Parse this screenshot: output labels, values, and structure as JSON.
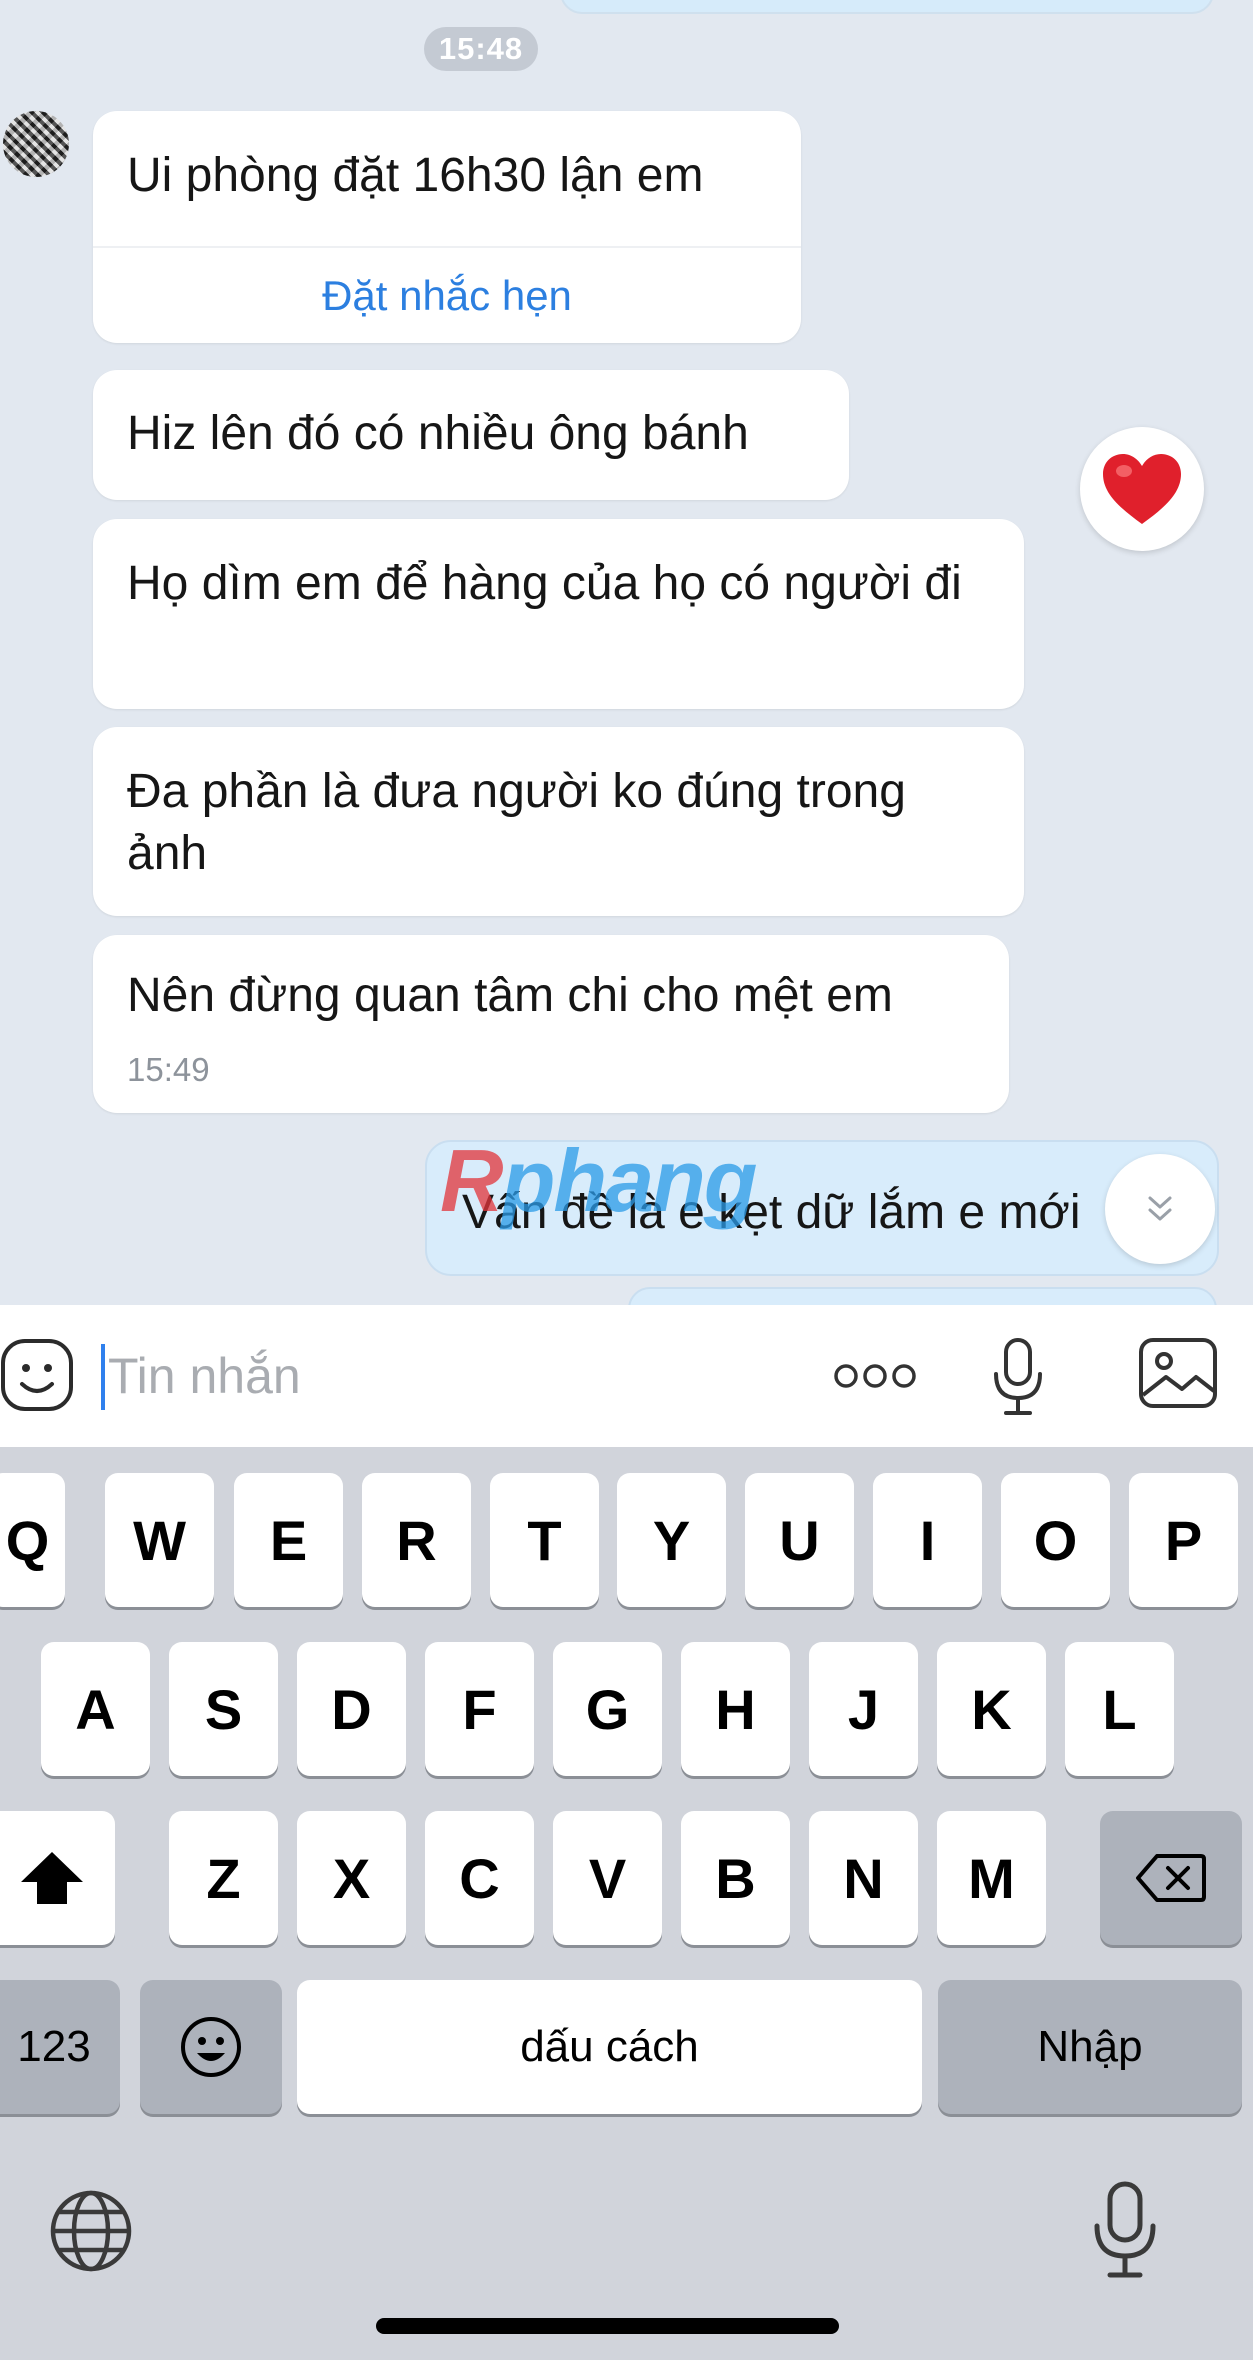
{
  "chat": {
    "time_separator": "15:48",
    "messages": [
      {
        "text": "Ui phòng đặt 16h30 lận em",
        "action": "Đặt nhắc hẹn"
      },
      {
        "text": "Hiz lên đó có nhiều ông bánh",
        "reaction": "heart"
      },
      {
        "text": "Họ dìm em để hàng của họ có người đi"
      },
      {
        "text": "Đa phần là đưa người ko đúng trong ảnh"
      },
      {
        "text": "Nên đừng quan tâm chi cho mệt em",
        "time": "15:49"
      }
    ],
    "sent_message": "Vấn đề là e kẹt dữ lắm e mới",
    "watermark": "Rphang",
    "scroll_icon": "double-chevron-down-icon"
  },
  "composer": {
    "placeholder": "Tin nhắn",
    "value": "",
    "icons": [
      "sticker-icon",
      "more-icon",
      "microphone-icon",
      "image-icon"
    ]
  },
  "keyboard": {
    "row1": [
      "Q",
      "W",
      "E",
      "R",
      "T",
      "Y",
      "U",
      "I",
      "O",
      "P"
    ],
    "row2": [
      "A",
      "S",
      "D",
      "F",
      "G",
      "H",
      "J",
      "K",
      "L"
    ],
    "row3": [
      "Z",
      "X",
      "C",
      "V",
      "B",
      "N",
      "M"
    ],
    "numbers_key": "123",
    "space_key": "dấu cách",
    "return_key": "Nhập",
    "icons": [
      "shift-icon",
      "backspace-icon",
      "emoji-icon",
      "globe-icon",
      "dictation-icon"
    ]
  },
  "colors": {
    "chat_background": "#e2e8f0",
    "incoming_bubble": "#ffffff",
    "outgoing_bubble": "#d8ecfb",
    "link": "#2c7fe0",
    "keyboard_background": "#d1d4db",
    "caret": "#2f80ed"
  }
}
